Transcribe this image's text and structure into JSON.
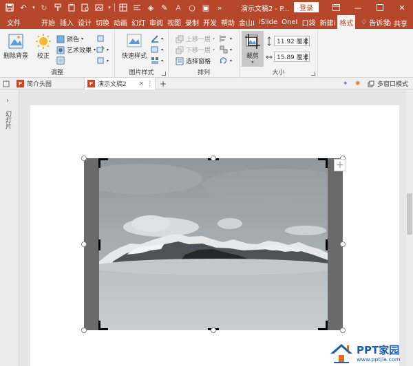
{
  "titlebar": {
    "title": "演示文稿2 - P...",
    "login": "登录"
  },
  "tabs": [
    "文件",
    "开始",
    "插入",
    "设计",
    "切换",
    "动画",
    "幻灯",
    "审阅",
    "视图",
    "录制",
    "开发",
    "帮助",
    "金山I",
    "iSlide",
    "OneI",
    "口袋",
    "新建i",
    "格式"
  ],
  "tell_me": "告诉我",
  "share": "共享",
  "ribbon": {
    "adjust": {
      "remove_bg": "删除背景",
      "correct": "校正",
      "color": "颜色",
      "art_effect": "艺术效果",
      "label": "调整"
    },
    "picture_style": {
      "quick_style": "快速样式",
      "label": "图片样式"
    },
    "arrange": {
      "bring_forward": "上移一层",
      "send_backward": "下移一层",
      "selection_pane": "选择窗格",
      "label": "排列"
    },
    "size": {
      "crop": "裁剪",
      "height": "11.92 厘米",
      "width": "15.89 厘米",
      "label": "大小"
    }
  },
  "doc_tabs": {
    "tab1": "简介头图",
    "tab2": "演示文稿2",
    "multi_window": "多窗口模式"
  },
  "left_pane": {
    "label": "幻灯片"
  },
  "watermark": {
    "title": "PPT家园",
    "url": "www.pptjia.com"
  },
  "colors": {
    "accent": "#b7472a",
    "tab_active_text": "#b7472a",
    "ribbon_bg": "#f3f3f3"
  }
}
